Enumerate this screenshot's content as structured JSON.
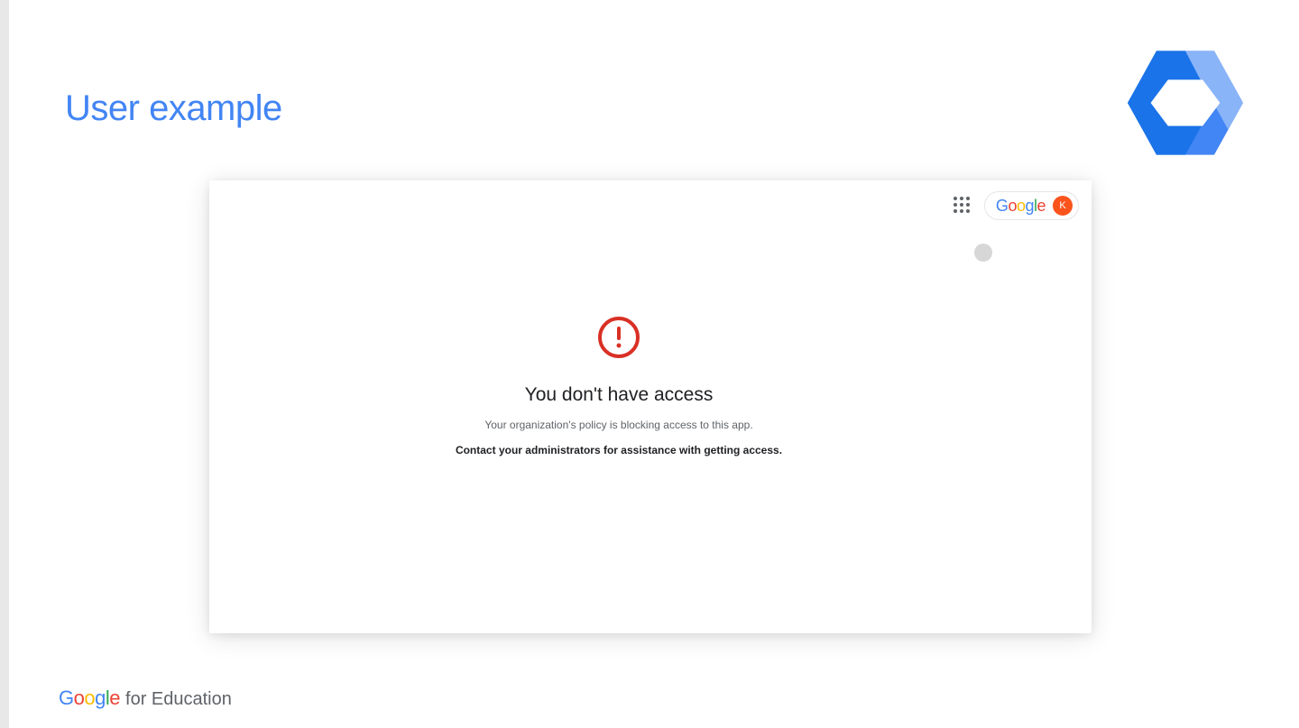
{
  "slide": {
    "title": "User example"
  },
  "appHeader": {
    "googleWord": "Google",
    "avatarInitial": "K"
  },
  "error": {
    "title": "You don't have access",
    "subtitle": "Your organization's policy is blocking access to this app.",
    "contact": "Contact your administrators for assistance with getting access."
  },
  "footer": {
    "brand": "Google",
    "suffix": "for Education"
  }
}
